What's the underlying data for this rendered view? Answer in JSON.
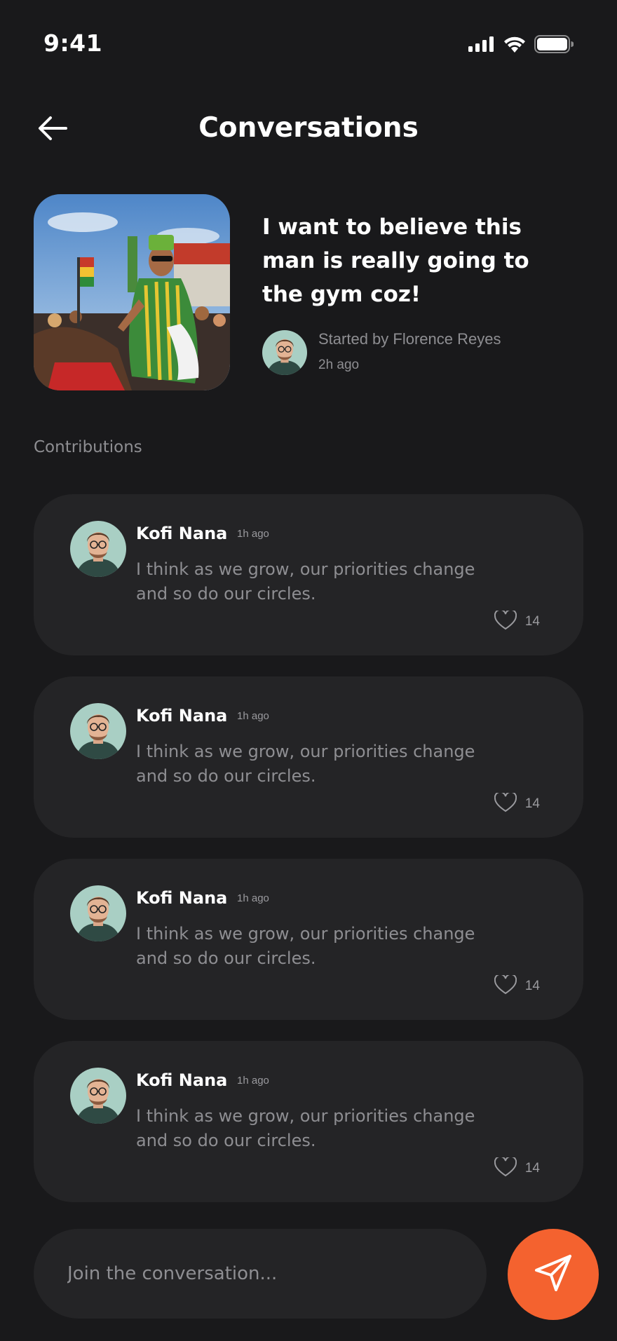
{
  "status_bar": {
    "time": "9:41",
    "icons": [
      "cellular-signal-icon",
      "wifi-icon",
      "battery-icon"
    ]
  },
  "header": {
    "back_icon": "arrow-left-icon",
    "title": "Conversations"
  },
  "conversation": {
    "image_icon": "festival-rider-photo",
    "title": "I want to believe this man is really going to the gym coz!",
    "started_by": "Started by Florence Reyes",
    "time_ago": "2h ago"
  },
  "contributions": {
    "label": "Contributions",
    "items": [
      {
        "author": "Kofi Nana",
        "time": "1h ago",
        "text": "I think as we grow, our priorities change and so do our circles.",
        "likes": "14"
      },
      {
        "author": "Kofi Nana",
        "time": "1h ago",
        "text": "I think as we grow, our priorities change and so do our circles.",
        "likes": "14"
      },
      {
        "author": "Kofi Nana",
        "time": "1h ago",
        "text": "I think as we grow, our priorities change and so do our circles.",
        "likes": "14"
      },
      {
        "author": "Kofi Nana",
        "time": "1h ago",
        "text": "I think as we grow, our priorities change and so do our circles.",
        "likes": "14"
      }
    ]
  },
  "composer": {
    "placeholder": "Join the conversation...",
    "value": ""
  },
  "colors": {
    "background": "#19191b",
    "card": "#242426",
    "accent": "#f4622f",
    "muted_text": "#8e8e92"
  }
}
